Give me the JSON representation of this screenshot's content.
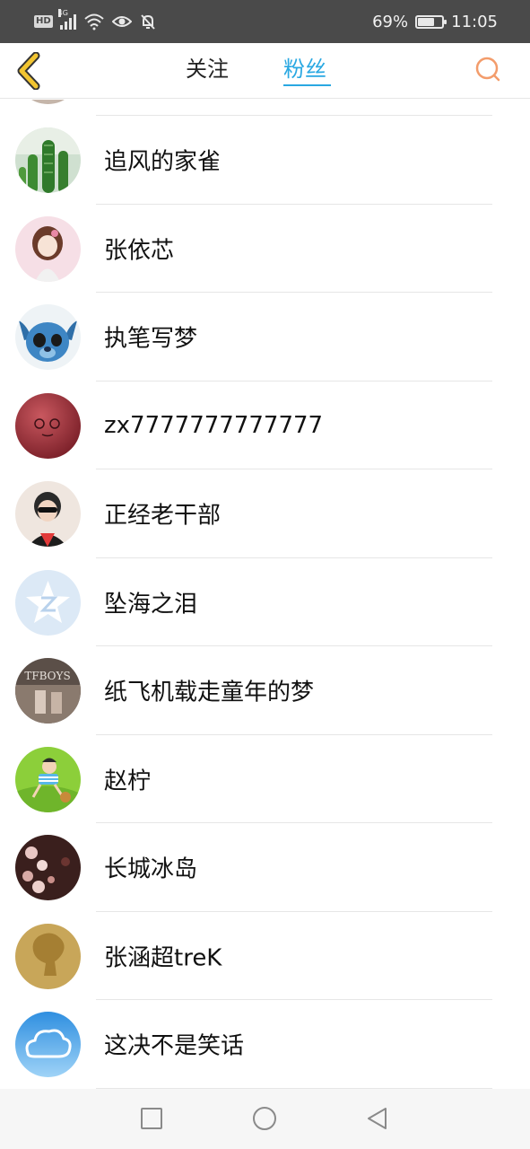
{
  "status_bar": {
    "left_icons": [
      "hd-icon",
      "signal-4g-icon",
      "wifi-icon",
      "eye-icon",
      "mute-bell-icon"
    ],
    "hd_label": "HD",
    "network_label": "4G",
    "battery_percent": "69%",
    "battery_level": 0.69,
    "time": "11:05"
  },
  "header": {
    "back_icon": "chevron-left-icon",
    "tabs": [
      {
        "label": "关注",
        "active": false
      },
      {
        "label": "粉丝",
        "active": true
      }
    ],
    "search_icon": "search-icon",
    "accent_color": "#29a8e2",
    "back_icon_color": "#f2c531",
    "search_icon_color": "#f39c6b"
  },
  "fans": [
    {
      "name": "追风的家雀",
      "avatar": "cactus-avatar"
    },
    {
      "name": "张依芯",
      "avatar": "girl-doll-avatar"
    },
    {
      "name": "执笔写梦",
      "avatar": "stitch-avatar"
    },
    {
      "name": "zx7777777777777",
      "avatar": "red-ball-avatar"
    },
    {
      "name": "正经老干部",
      "avatar": "boy-photo-avatar"
    },
    {
      "name": "坠海之泪",
      "avatar": "qzone-star-avatar"
    },
    {
      "name": "纸飞机载走童年的梦",
      "avatar": "tfboys-avatar"
    },
    {
      "name": "赵柠",
      "avatar": "cartoon-boy-avatar"
    },
    {
      "name": "长城冰岛",
      "avatar": "blossom-avatar"
    },
    {
      "name": "张涵超treK",
      "avatar": "gold-silhouette-avatar"
    },
    {
      "name": "这决不是笑话",
      "avatar": "cloud-sky-avatar"
    }
  ],
  "nav_bar": {
    "buttons": [
      "recent-apps-icon",
      "home-icon",
      "back-triangle-icon"
    ]
  }
}
